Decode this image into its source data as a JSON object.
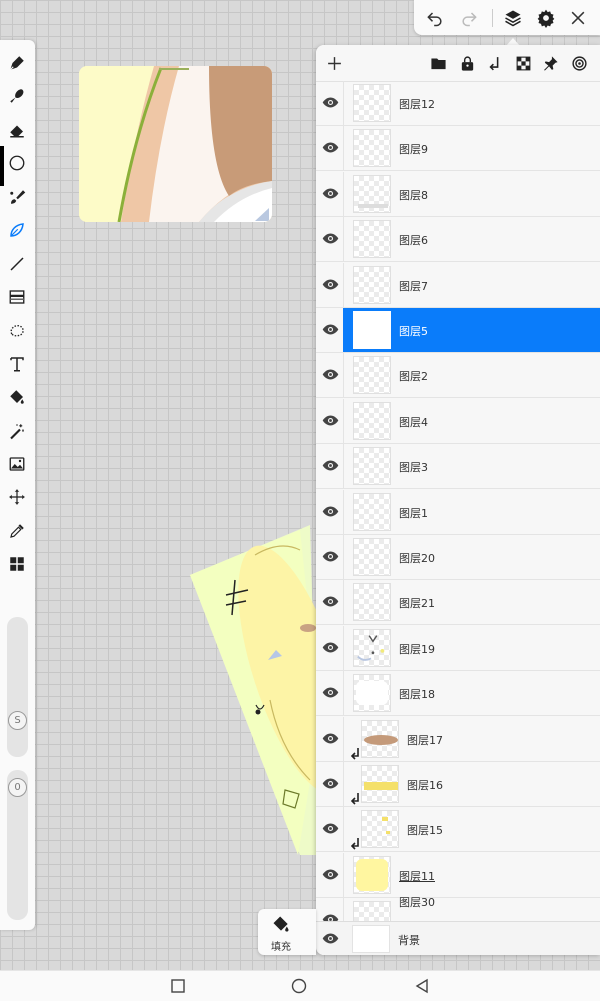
{
  "toolbar": {
    "tools": [
      "pen-icon",
      "smudge-icon",
      "eraser-icon",
      "color-circle-icon",
      "brush-icon",
      "lasso-pen-icon",
      "line-icon",
      "gradient-icon",
      "lasso-select-icon",
      "text-icon",
      "bucket-icon",
      "magic-wand-icon",
      "image-icon",
      "transform-icon",
      "eyedropper-icon",
      "grid-icon"
    ],
    "size_slider_label": "S",
    "opacity_slider_label": "0"
  },
  "topbar": {
    "buttons": [
      "undo-icon",
      "redo-icon",
      "layers-icon",
      "settings-icon",
      "close-icon"
    ]
  },
  "layers_panel": {
    "toolbar_buttons": [
      "add-icon",
      "folder-icon",
      "lock-icon",
      "merge-down-icon",
      "transparency-icon",
      "pin-icon",
      "target-icon"
    ],
    "layers": [
      {
        "name": "图层12",
        "selected": false,
        "clipped": false
      },
      {
        "name": "图层9",
        "selected": false,
        "clipped": false
      },
      {
        "name": "图层8",
        "selected": false,
        "clipped": false
      },
      {
        "name": "图层6",
        "selected": false,
        "clipped": false
      },
      {
        "name": "图层7",
        "selected": false,
        "clipped": false
      },
      {
        "name": "图层5",
        "selected": true,
        "clipped": false
      },
      {
        "name": "图层2",
        "selected": false,
        "clipped": false
      },
      {
        "name": "图层4",
        "selected": false,
        "clipped": false
      },
      {
        "name": "图层3",
        "selected": false,
        "clipped": false
      },
      {
        "name": "图层1",
        "selected": false,
        "clipped": false
      },
      {
        "name": "图层20",
        "selected": false,
        "clipped": false
      },
      {
        "name": "图层21",
        "selected": false,
        "clipped": false
      },
      {
        "name": "图层19",
        "selected": false,
        "clipped": false
      },
      {
        "name": "图层18",
        "selected": false,
        "clipped": false
      },
      {
        "name": "图层17",
        "selected": false,
        "clipped": true
      },
      {
        "name": "图层16",
        "selected": false,
        "clipped": true
      },
      {
        "name": "图层15",
        "selected": false,
        "clipped": true
      },
      {
        "name": "图层11",
        "selected": false,
        "clipped": false,
        "underline": true
      },
      {
        "name": "图层30",
        "selected": false,
        "clipped": false,
        "partial": true
      }
    ],
    "background_label": "背景"
  },
  "fill_button": {
    "label": "填充"
  },
  "navbar": {
    "buttons": [
      "recent-apps-icon",
      "home-icon",
      "back-icon"
    ]
  },
  "colors": {
    "accent": "#0a7cfa",
    "selected_color": "#000000"
  }
}
